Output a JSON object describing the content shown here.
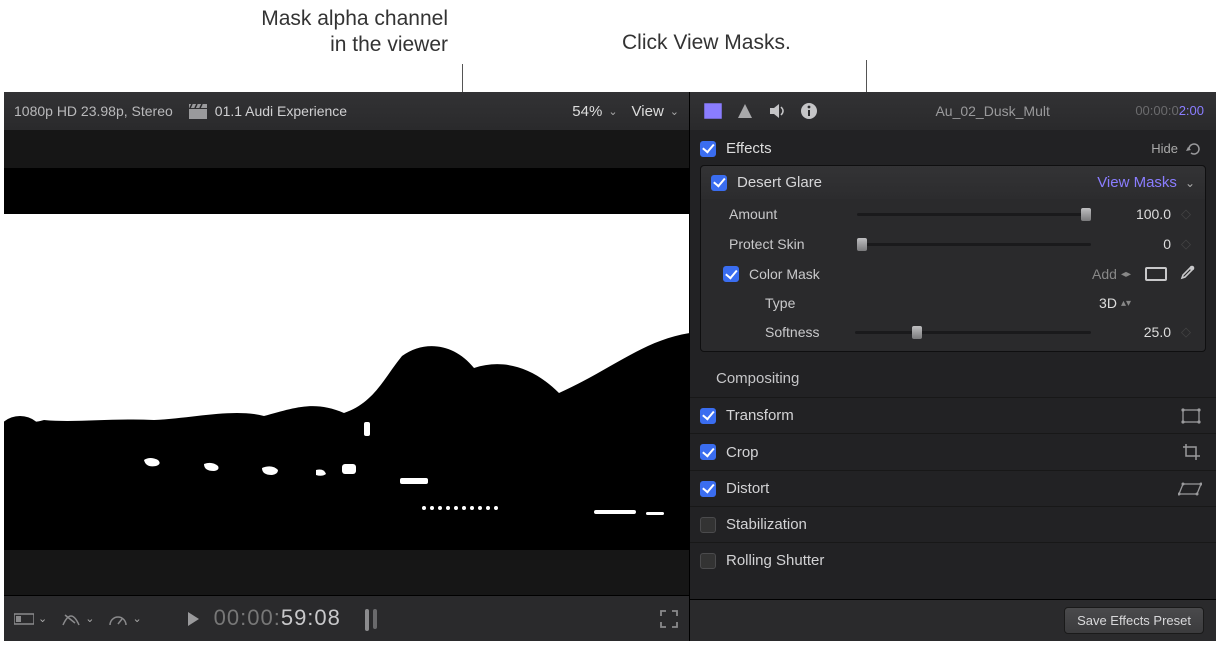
{
  "callouts": {
    "left_line1": "Mask alpha channel",
    "left_line2": "in the viewer",
    "right": "Click View Masks."
  },
  "viewer": {
    "format": "1080p HD 23.98p, Stereo",
    "clip_title": "01.1 Audi Experience",
    "zoom": "54%",
    "view_label": "View",
    "timecode_small": "00:00:",
    "timecode_big": "59:08"
  },
  "inspector": {
    "clip_name": "Au_02_Dusk_Mult",
    "timecode_grey": "00:00:0",
    "timecode_hl": "2:00",
    "effects_header": "Effects",
    "hide_label": "Hide",
    "effect": {
      "name": "Desert Glare",
      "view_masks": "View Masks",
      "amount_label": "Amount",
      "amount_value": "100.0",
      "protect_label": "Protect Skin",
      "protect_value": "0",
      "color_mask_label": "Color Mask",
      "add_label": "Add",
      "type_label": "Type",
      "type_value": "3D",
      "softness_label": "Softness",
      "softness_value": "25.0"
    },
    "compositing": "Compositing",
    "transform": "Transform",
    "crop": "Crop",
    "distort": "Distort",
    "stabilization": "Stabilization",
    "rolling_shutter": "Rolling Shutter",
    "save_preset": "Save Effects Preset"
  }
}
